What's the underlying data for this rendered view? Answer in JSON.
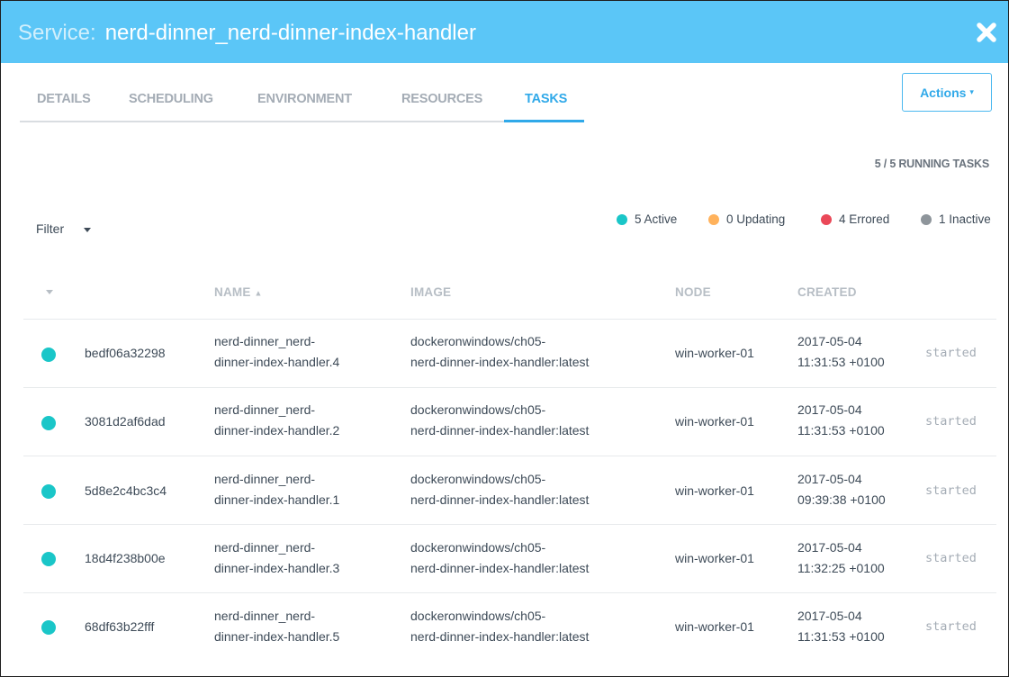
{
  "header": {
    "label": "Service:",
    "service_name": "nerd-dinner_nerd-dinner-index-handler",
    "close_glyph": "✖",
    "background": "#5bc6f7"
  },
  "tabs": [
    {
      "label": "DETAILS",
      "active": false
    },
    {
      "label": "SCHEDULING",
      "active": false
    },
    {
      "label": "ENVIRONMENT",
      "active": false
    },
    {
      "label": "RESOURCES",
      "active": false
    },
    {
      "label": "TASKS",
      "active": true
    }
  ],
  "actions": {
    "label": "Actions",
    "caret": "▾"
  },
  "running_tasks": "5 / 5 RUNNING TASKS",
  "filter": {
    "label": "Filter"
  },
  "legend": [
    {
      "label": "5 Active",
      "color": "#1ac6c8"
    },
    {
      "label": "0 Updating",
      "color": "#ffb25c"
    },
    {
      "label": "4 Errored",
      "color": "#ea4858"
    },
    {
      "label": "1 Inactive",
      "color": "#8e959b"
    }
  ],
  "table": {
    "columns": {
      "name": "NAME",
      "name_sort": "▲",
      "image": "IMAGE",
      "node": "NODE",
      "created": "CREATED"
    },
    "rows": [
      {
        "id": "bedf06a32298",
        "name1": "nerd-dinner_nerd-",
        "name2": "dinner-index-handler.4",
        "image1": "dockeronwindows/ch05-",
        "image2": "nerd-dinner-index-handler:latest",
        "node": "win-worker-01",
        "date": "2017-05-04",
        "time": "11:31:53 +0100",
        "state": "started",
        "status_color": "#1ac6c8"
      },
      {
        "id": "3081d2af6dad",
        "name1": "nerd-dinner_nerd-",
        "name2": "dinner-index-handler.2",
        "image1": "dockeronwindows/ch05-",
        "image2": "nerd-dinner-index-handler:latest",
        "node": "win-worker-01",
        "date": "2017-05-04",
        "time": "11:31:53 +0100",
        "state": "started",
        "status_color": "#1ac6c8"
      },
      {
        "id": "5d8e2c4bc3c4",
        "name1": "nerd-dinner_nerd-",
        "name2": "dinner-index-handler.1",
        "image1": "dockeronwindows/ch05-",
        "image2": "nerd-dinner-index-handler:latest",
        "node": "win-worker-01",
        "date": "2017-05-04",
        "time": "09:39:38 +0100",
        "state": "started",
        "status_color": "#1ac6c8"
      },
      {
        "id": "18d4f238b00e",
        "name1": "nerd-dinner_nerd-",
        "name2": "dinner-index-handler.3",
        "image1": "dockeronwindows/ch05-",
        "image2": "nerd-dinner-index-handler:latest",
        "node": "win-worker-01",
        "date": "2017-05-04",
        "time": "11:32:25 +0100",
        "state": "started",
        "status_color": "#1ac6c8"
      },
      {
        "id": "68df63b22fff",
        "name1": "nerd-dinner_nerd-",
        "name2": "dinner-index-handler.5",
        "image1": "dockeronwindows/ch05-",
        "image2": "nerd-dinner-index-handler:latest",
        "node": "win-worker-01",
        "date": "2017-05-04",
        "time": "11:31:53 +0100",
        "state": "started",
        "status_color": "#1ac6c8"
      }
    ]
  }
}
